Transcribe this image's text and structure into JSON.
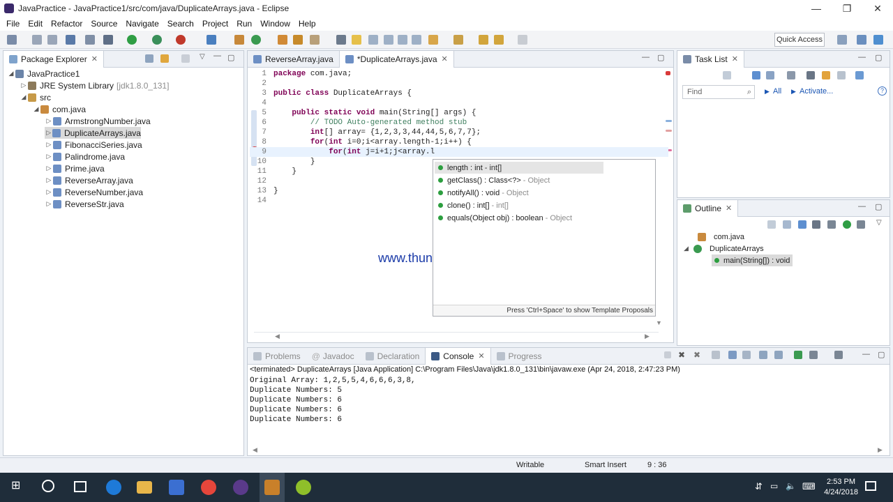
{
  "window": {
    "title": "JavaPractice - JavaPractice1/src/com/java/DuplicateArrays.java - Eclipse",
    "controls": [
      "—",
      "❐",
      "✕"
    ]
  },
  "menu": [
    "File",
    "Edit",
    "Refactor",
    "Source",
    "Navigate",
    "Search",
    "Project",
    "Run",
    "Window",
    "Help"
  ],
  "toolbar": {
    "quick_access": "Quick Access"
  },
  "package_explorer": {
    "tab_label": "Package Explorer",
    "project": "JavaPractice1",
    "jre": "JRE System Library",
    "jre_version": "[jdk1.8.0_131]",
    "src": "src",
    "package": "com.java",
    "files": [
      "ArmstrongNumber.java",
      "DuplicateArrays.java",
      "FibonacciSeries.java",
      "Palindrome.java",
      "Prime.java",
      "ReverseArray.java",
      "ReverseNumber.java",
      "ReverseStr.java"
    ]
  },
  "editor": {
    "tabs": [
      "ReverseArray.java",
      "*DuplicateArrays.java"
    ],
    "line_numbers": [
      "1",
      "2",
      "3",
      "4",
      "5",
      "6",
      "7",
      "8",
      "9",
      "10",
      "11",
      "12",
      "13",
      "14"
    ],
    "lines": {
      "l1_kw": "package",
      "l1_rest": " com.java;",
      "l3_kw": "public class",
      "l3_rest": " DuplicateArrays {",
      "l5_kw": "public static void",
      "l5_rest": " main(String[] args) {",
      "l6_cm": "// TODO Auto-generated method stub",
      "l7_kw": "int",
      "l7_rest": "[] array= {1,2,3,3,44,44,5,6,7,7};",
      "l8_kw1": "for",
      "l8_mid1": "(",
      "l8_kw2": "int",
      "l8_rest": " i=0;i<array.length-1;i++) {",
      "l9_kw1": "for",
      "l9_mid1": "(",
      "l9_kw2": "int",
      "l9_rest": " j=i+1;j<array.l",
      "l10": "}",
      "l11": "}",
      "l13": "}"
    }
  },
  "proposals": {
    "items": [
      {
        "name": "length : int",
        "type": "- int[]"
      },
      {
        "name": "getClass() : Class<?>",
        "type": "- Object"
      },
      {
        "name": "notifyAll() : void",
        "type": "- Object"
      },
      {
        "name": "clone() : int[]",
        "type": "- int[]"
      },
      {
        "name": "equals(Object obj) : boolean",
        "type": "- Object"
      }
    ],
    "footer": "Press 'Ctrl+Space' to show Template Proposals"
  },
  "watermark": "www.thundershare.net",
  "task_list": {
    "tab_label": "Task List",
    "find_placeholder": "Find",
    "all": "All",
    "activate": "Activate..."
  },
  "outline": {
    "tab_label": "Outline",
    "package": "com.java",
    "class": "DuplicateArrays",
    "method": "main(String[]) : void"
  },
  "bottom_panel": {
    "tabs": [
      "Problems",
      "Javadoc",
      "Declaration",
      "Console",
      "Progress"
    ],
    "terminated": "<terminated> DuplicateArrays [Java Application] C:\\Program Files\\Java\\jdk1.8.0_131\\bin\\javaw.exe (Apr 24, 2018, 2:47:23 PM)",
    "output": [
      "Original Array: 1,2,5,5,4,6,6,6,3,8,",
      "Duplicate Numbers: 5",
      "Duplicate Numbers: 6",
      "Duplicate Numbers: 6",
      "Duplicate Numbers: 6"
    ]
  },
  "status": {
    "writable": "Writable",
    "insert_mode": "Smart Insert",
    "position": "9 : 36"
  },
  "taskbar": {
    "time": "2:53 PM",
    "date": "4/24/2018"
  }
}
